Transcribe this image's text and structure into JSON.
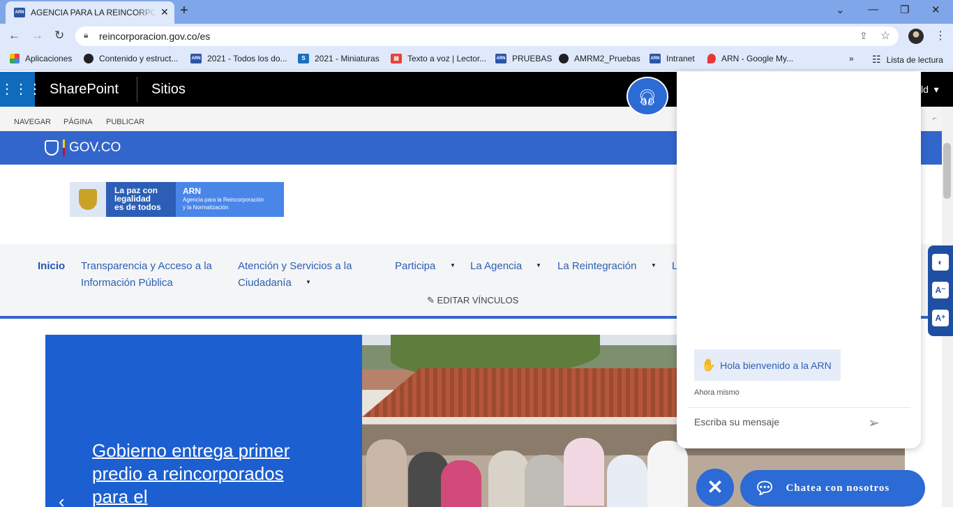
{
  "browser": {
    "tab_title": "AGENCIA PARA LA REINCORPORACIÓN",
    "tab_favicon": "ARN",
    "url": "reincorporacion.gov.co/es",
    "bookmarks": [
      {
        "label": "Aplicaciones",
        "icon": "apps-grid-icon"
      },
      {
        "label": "Contenido y estruct...",
        "icon": "globe-icon"
      },
      {
        "label": "2021 - Todos los do...",
        "icon": "arn-icon"
      },
      {
        "label": "2021 - Miniaturas",
        "icon": "sharepoint-icon"
      },
      {
        "label": "Texto a voz | Lector...",
        "icon": "document-icon"
      },
      {
        "label": "PRUEBAS",
        "icon": "arn-icon"
      },
      {
        "label": "AMRM2_Pruebas",
        "icon": "globe-icon"
      },
      {
        "label": "Intranet",
        "icon": "arn-icon"
      },
      {
        "label": "ARN - Google My...",
        "icon": "map-pin-icon"
      }
    ],
    "reading_list": "Lista de lectura"
  },
  "sharepoint": {
    "app_name": "SharePoint",
    "section": "Sitios",
    "ribbon": [
      "NAVEGAR",
      "PÁGINA",
      "PUBLICAR"
    ]
  },
  "gov": {
    "brand": "GOV.CO"
  },
  "arn_logo": {
    "line1": "La paz con",
    "line2": "legalidad",
    "line3": "es de todos",
    "name": "ARN",
    "sub1": "Agencia para la Reincorporación",
    "sub2": "y la Normalización"
  },
  "nav": {
    "items": [
      {
        "line1": "Inicio",
        "line2": ""
      },
      {
        "line1": "Transparencia y Acceso a la",
        "line2": "Información Pública"
      },
      {
        "line1": "Atención y Servicios a la",
        "line2": "Ciudadanía"
      },
      {
        "line1": "Participa",
        "line2": ""
      },
      {
        "line1": "La Agencia",
        "line2": ""
      },
      {
        "line1": "La Reintegración",
        "line2": ""
      },
      {
        "line1": "L",
        "line2": ""
      }
    ],
    "edit_links": "EDITAR VÍNCULOS"
  },
  "hero": {
    "title": "Gobierno entrega primer predio a reincorporados para el"
  },
  "chat": {
    "greeting": "Hola bienvenido a la ARN",
    "timestamp": "Ahora mismo",
    "input_placeholder": "Escriba su mensaje",
    "launcher_label": "Chatea con nosotros"
  },
  "sp_user_fragment": "ld",
  "colors": {
    "gov_blue": "#3366cc",
    "chat_blue": "#2c6ad5",
    "hero_blue": "#1c5fd0",
    "tab_strip": "#7fa6e8"
  }
}
